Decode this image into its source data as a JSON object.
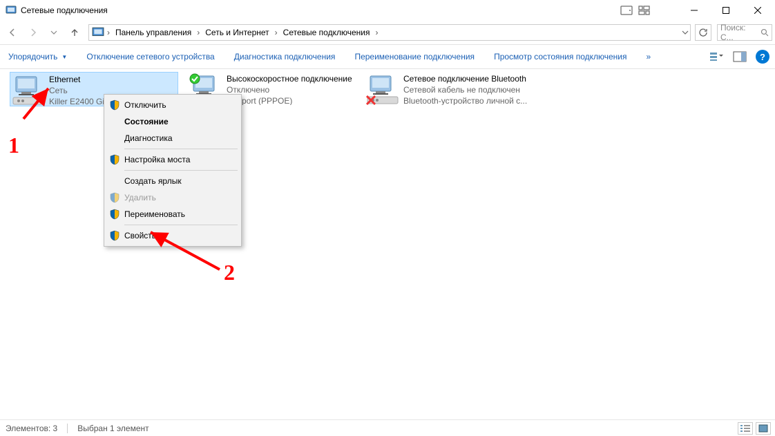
{
  "window": {
    "title": "Сетевые подключения"
  },
  "breadcrumb": {
    "items": [
      "Панель управления",
      "Сеть и Интернет",
      "Сетевые подключения"
    ]
  },
  "search": {
    "placeholder": "Поиск: С..."
  },
  "cmdbar": {
    "organize": "Упорядочить",
    "disable": "Отключение сетевого устройства",
    "diagnose": "Диагностика подключения",
    "rename": "Переименование подключения",
    "status": "Просмотр состояния подключения",
    "more": "»"
  },
  "connections": [
    {
      "name": "Ethernet",
      "status": "Сеть",
      "device": "Killer E2400 Gi..."
    },
    {
      "name": "Высокоскоростное подключение",
      "status": "Отключено",
      "device": "Miniport (PPPOE)"
    },
    {
      "name": "Сетевое подключение Bluetooth",
      "status": "Сетевой кабель не подключен",
      "device": "Bluetooth-устройство личной с..."
    }
  ],
  "context_menu": {
    "items": [
      {
        "label": "Отключить",
        "shield": true
      },
      {
        "label": "Состояние",
        "default": true
      },
      {
        "label": "Диагностика"
      },
      "sep",
      {
        "label": "Настройка моста",
        "shield": true
      },
      "sep",
      {
        "label": "Создать ярлык"
      },
      {
        "label": "Удалить",
        "shield": true,
        "disabled": true
      },
      {
        "label": "Переименовать",
        "shield": true
      },
      "sep",
      {
        "label": "Свойства",
        "shield": true
      }
    ]
  },
  "statusbar": {
    "items_count": "Элементов: 3",
    "selection": "Выбран 1 элемент"
  },
  "annotations": {
    "one": "1",
    "two": "2"
  }
}
